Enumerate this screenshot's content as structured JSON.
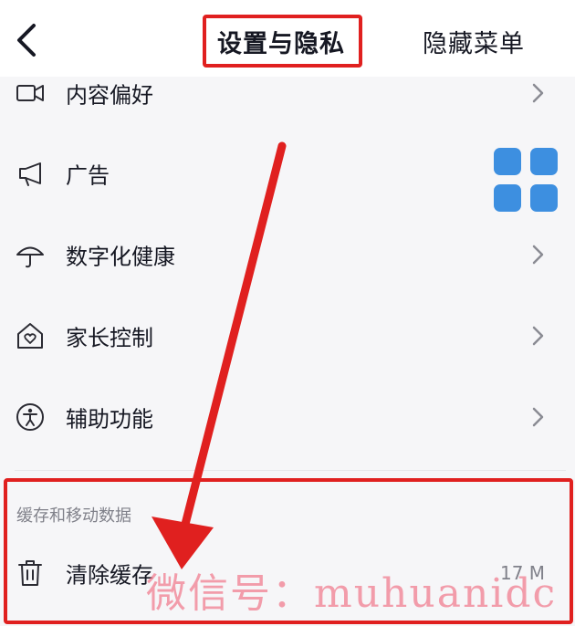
{
  "header": {
    "title": "设置与隐私",
    "right_action": "隐藏菜单",
    "back_icon": "chevron-left-icon"
  },
  "items": [
    {
      "label": "内容偏好",
      "icon": "video-camera-icon"
    },
    {
      "label": "广告",
      "icon": "megaphone-icon"
    },
    {
      "label": "数字化健康",
      "icon": "umbrella-icon"
    },
    {
      "label": "家长控制",
      "icon": "home-heart-icon"
    },
    {
      "label": "辅助功能",
      "icon": "accessibility-icon"
    }
  ],
  "section": {
    "title": "缓存和移动数据",
    "items": [
      {
        "label": "清除缓存",
        "icon": "trash-icon",
        "value": "17 M"
      }
    ]
  },
  "overlay": {
    "watermark": "微信号：muhuanidc"
  },
  "colors": {
    "highlight": "#e0201f",
    "floating_grid": "#3d8fe0",
    "text_primary": "#161823",
    "text_secondary": "#80818a"
  }
}
